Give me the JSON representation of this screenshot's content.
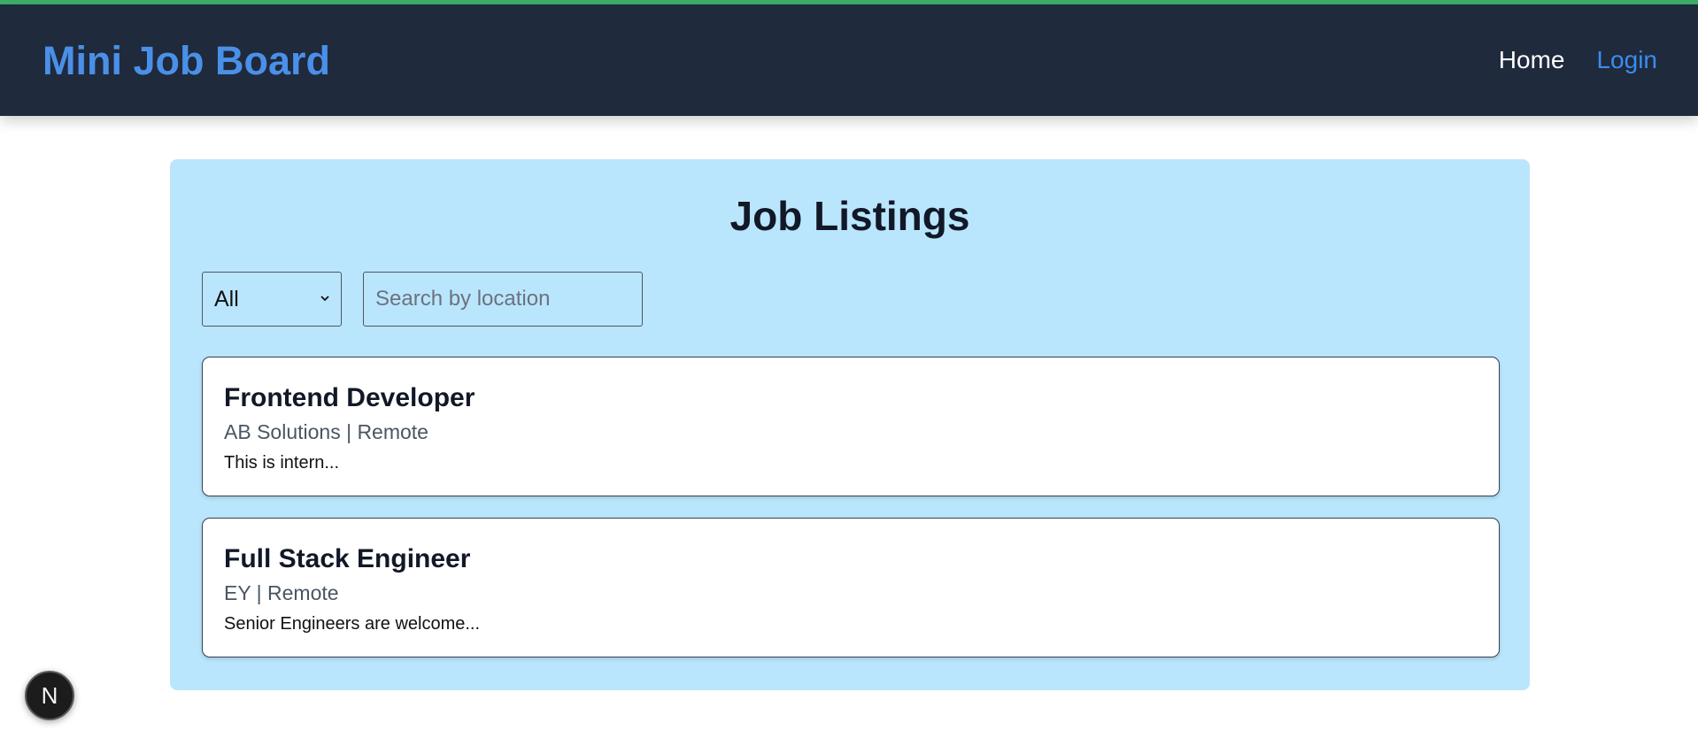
{
  "header": {
    "brand": "Mini Job Board",
    "nav": {
      "home": "Home",
      "login": "Login"
    }
  },
  "main": {
    "title": "Job Listings",
    "filters": {
      "type_selected": "All",
      "location_placeholder": "Search by location",
      "location_value": ""
    },
    "jobs": [
      {
        "title": "Frontend Developer",
        "meta": "AB Solutions | Remote",
        "description": "This is intern..."
      },
      {
        "title": "Full Stack Engineer",
        "meta": "EY | Remote",
        "description": "Senior Engineers are welcome..."
      }
    ]
  },
  "dev_badge": {
    "letter": "N",
    "icon": "nextjs-dev-indicator-icon"
  },
  "colors": {
    "top_accent": "#3fae6a",
    "navbar_bg": "#1f2a3c",
    "brand": "#4a90e8",
    "login_link": "#3a8cf0",
    "panel_bg": "#bae6fd"
  }
}
